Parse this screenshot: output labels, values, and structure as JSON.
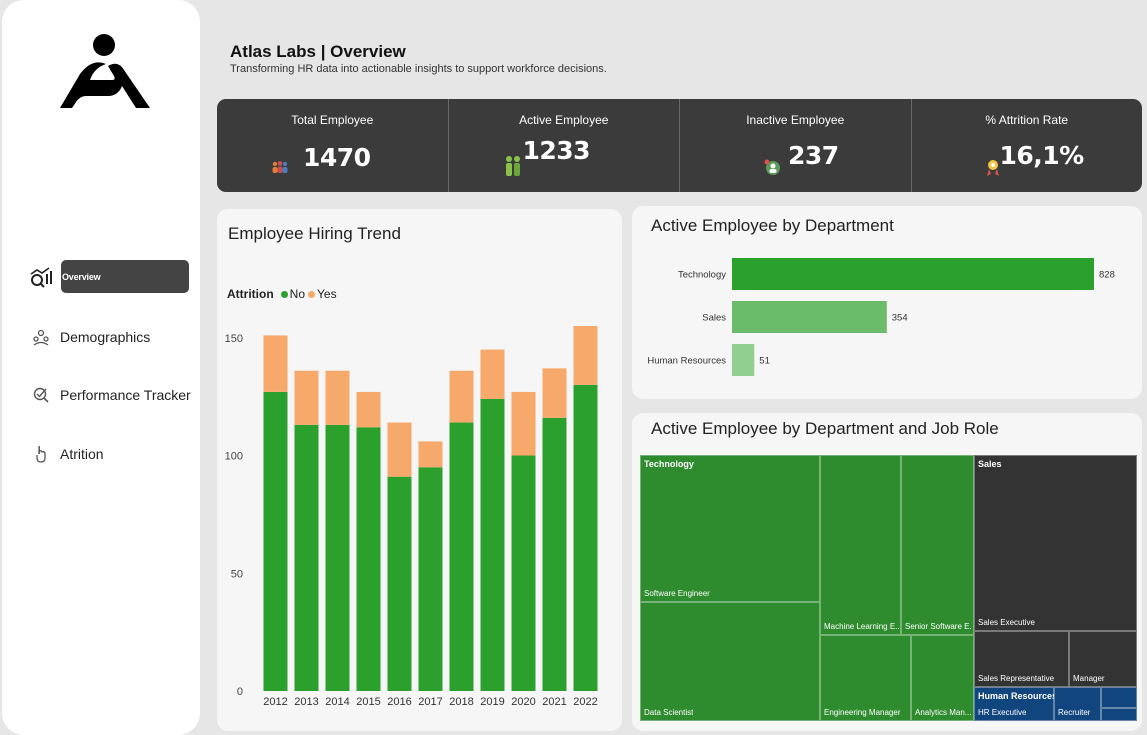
{
  "header": {
    "title": "Atlas Labs | Overview",
    "subtitle": "Transforming HR data into actionable insights to support workforce decisions."
  },
  "nav": {
    "items": [
      {
        "label": "Overview",
        "icon": "chart-analytics-icon",
        "active": true
      },
      {
        "label": "Demographics",
        "icon": "people-network-icon",
        "active": false
      },
      {
        "label": "Performance Tracker",
        "icon": "performance-check-icon",
        "active": false
      },
      {
        "label": "Atrition",
        "icon": "hand-pointer-icon",
        "active": false
      }
    ]
  },
  "kpis": [
    {
      "label": "Total Employee",
      "value": "1470",
      "icon": "group-people-icon"
    },
    {
      "label": "Active Employee",
      "value": "1233",
      "icon": "active-people-icon"
    },
    {
      "label": "Inactive Employee",
      "value": "237",
      "icon": "inactive-person-icon"
    },
    {
      "label": "% Attrition  Rate",
      "value": "16,1%",
      "icon": "attrition-rate-icon"
    }
  ],
  "colors": {
    "no": "#2ca02c",
    "yes": "#f7a86b",
    "dark": "#333333",
    "hr_blue": "#11457e"
  },
  "hiring_trend": {
    "title": "Employee Hiring Trend",
    "legend_title": "Attrition",
    "legend_no": "No",
    "legend_yes": "Yes"
  },
  "department": {
    "title": "Active Employee by Department"
  },
  "treemap": {
    "title": "Active Employee by Department and Job Role",
    "groups": {
      "technology": "Technology",
      "sales": "Sales",
      "hr": "Human Resources"
    },
    "roles": {
      "software_engineer": "Software Engineer",
      "data_scientist": "Data Scientist",
      "ml_engineer": "Machine Learning E...",
      "senior_swe": "Senior Software E...",
      "eng_manager": "Engineering Manager",
      "analytics_manager": "Analytics Man...",
      "sales_exec": "Sales Executive",
      "sales_rep": "Sales Representative",
      "manager": "Manager",
      "hr_exec": "HR Executive",
      "recruiter": "Recruiter"
    }
  },
  "chart_data": [
    {
      "type": "bar",
      "stacked": true,
      "title": "Employee Hiring Trend",
      "categories": [
        "2012",
        "2013",
        "2014",
        "2015",
        "2016",
        "2017",
        "2018",
        "2019",
        "2020",
        "2021",
        "2022"
      ],
      "series": [
        {
          "name": "No",
          "values": [
            127,
            113,
            113,
            112,
            91,
            95,
            114,
            124,
            100,
            116,
            130
          ]
        },
        {
          "name": "Yes",
          "values": [
            24,
            23,
            23,
            15,
            23,
            11,
            22,
            21,
            27,
            21,
            25
          ]
        }
      ],
      "ylim": [
        0,
        155
      ],
      "yticks": [
        0,
        50,
        100,
        150
      ],
      "legend": "top-left"
    },
    {
      "type": "bar",
      "orientation": "horizontal",
      "title": "Active Employee by Department",
      "categories": [
        "Technology",
        "Sales",
        "Human Resources"
      ],
      "values": [
        828,
        354,
        51
      ],
      "colors": [
        "#2ca02c",
        "#6abb6a",
        "#91cf91"
      ]
    }
  ]
}
